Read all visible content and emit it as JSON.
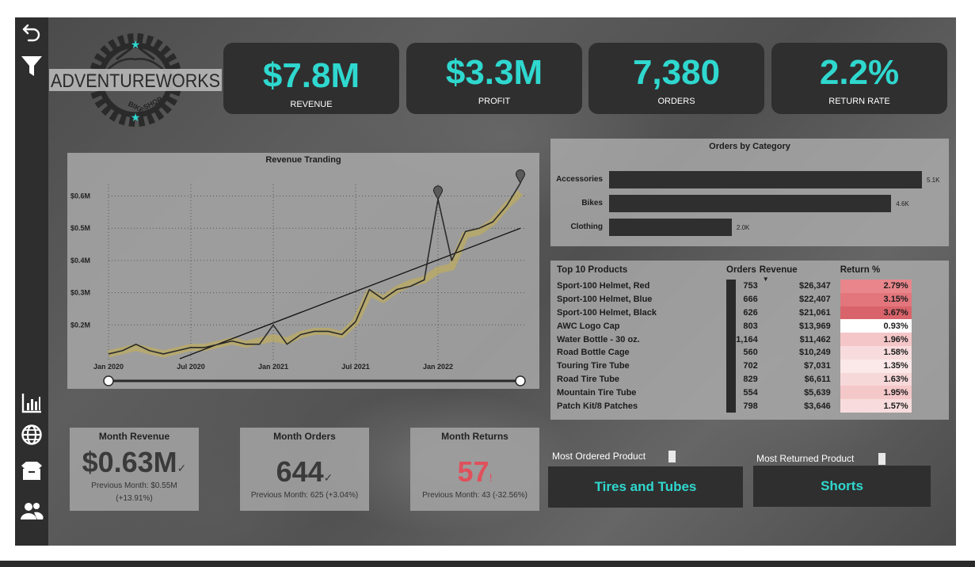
{
  "logo": {
    "brand": "ADVENTUREWORKS",
    "sub": "BIKE SHOP"
  },
  "sidebar": {
    "icons": [
      "back-arrow-icon",
      "filter-icon",
      "bar-chart-icon",
      "globe-icon",
      "box-icon",
      "users-icon"
    ]
  },
  "kpis": [
    {
      "value": "$7.8M",
      "label": "REVENUE"
    },
    {
      "value": "$3.3M",
      "label": "PROFIT"
    },
    {
      "value": "7,380",
      "label": "ORDERS"
    },
    {
      "value": "2.2%",
      "label": "RETURN RATE"
    }
  ],
  "revenue_chart": {
    "title": "Revenue Tranding",
    "y_ticks": [
      "$0.6M",
      "$0.5M",
      "$0.4M",
      "$0.3M",
      "$0.2M"
    ],
    "x_ticks": [
      "Jan 2020",
      "Jul 2020",
      "Jan 2021",
      "Jul 2021",
      "Jan 2022"
    ]
  },
  "chart_data": {
    "type": "line",
    "title": "Revenue Tranding",
    "x_start": "Jan 2020",
    "x_interval": "month",
    "ylim": [
      0.1,
      0.68
    ],
    "y_unit": "$M",
    "series": [
      {
        "values": [
          0.11,
          0.12,
          0.14,
          0.12,
          0.11,
          0.12,
          0.13,
          0.13,
          0.14,
          0.15,
          0.14,
          0.14,
          0.2,
          0.14,
          0.17,
          0.18,
          0.18,
          0.17,
          0.21,
          0.31,
          0.28,
          0.31,
          0.32,
          0.34,
          0.59,
          0.4,
          0.49,
          0.5,
          0.52,
          0.57,
          0.64
        ]
      },
      {
        "values": [
          0.11,
          0.12,
          0.13,
          0.12,
          0.11,
          0.12,
          0.13,
          0.13,
          0.14,
          0.15,
          0.14,
          0.15,
          0.16,
          0.15,
          0.17,
          0.18,
          0.18,
          0.17,
          0.21,
          0.3,
          0.28,
          0.31,
          0.33,
          0.34,
          0.37,
          0.38,
          0.48,
          0.49,
          0.52,
          0.57,
          0.61
        ]
      }
    ],
    "trend_line": {
      "start": 0.07,
      "end": 0.5
    },
    "grid": true
  },
  "orders_by_category": {
    "title": "Orders by Category",
    "rows": [
      {
        "label": "Accessories",
        "value": 5.1,
        "display": "5.1K"
      },
      {
        "label": "Bikes",
        "value": 4.6,
        "display": "4.6K"
      },
      {
        "label": "Clothing",
        "value": 2.0,
        "display": "2.0K"
      }
    ]
  },
  "top10": {
    "headers": {
      "product": "Top 10 Products",
      "orders": "Orders",
      "revenue": "Revenue",
      "ret": "Return %"
    },
    "rows": [
      {
        "product": "Sport-100 Helmet, Red",
        "orders": "753",
        "revenue": "$26,347",
        "ret": "2.79%",
        "ret_color": "#e8868b"
      },
      {
        "product": "Sport-100 Helmet, Blue",
        "orders": "666",
        "revenue": "$22,407",
        "ret": "3.15%",
        "ret_color": "#e2767c"
      },
      {
        "product": "Sport-100 Helmet, Black",
        "orders": "626",
        "revenue": "$21,061",
        "ret": "3.67%",
        "ret_color": "#d9636a"
      },
      {
        "product": "AWC Logo Cap",
        "orders": "803",
        "revenue": "$13,969",
        "ret": "0.93%",
        "ret_color": "#ffffff"
      },
      {
        "product": "Water Bottle - 30 oz.",
        "orders": "1,164",
        "revenue": "$11,462",
        "ret": "1.96%",
        "ret_color": "#f4c6c8"
      },
      {
        "product": "Road Bottle Cage",
        "orders": "560",
        "revenue": "$10,249",
        "ret": "1.58%",
        "ret_color": "#f8dcdd"
      },
      {
        "product": "Touring Tire Tube",
        "orders": "702",
        "revenue": "$7,031",
        "ret": "1.35%",
        "ret_color": "#fbe8e8"
      },
      {
        "product": "Road Tire Tube",
        "orders": "829",
        "revenue": "$6,611",
        "ret": "1.63%",
        "ret_color": "#f7d8d9"
      },
      {
        "product": "Mountain Tire Tube",
        "orders": "554",
        "revenue": "$5,639",
        "ret": "1.95%",
        "ret_color": "#f4c7c9"
      },
      {
        "product": "Patch Kit/8 Patches",
        "orders": "798",
        "revenue": "$3,646",
        "ret": "1.57%",
        "ret_color": "#f8dcdd"
      }
    ]
  },
  "cards": {
    "month_revenue": {
      "title": "Month Revenue",
      "value": "$0.63M",
      "prev": "Previous Month: $0.55M",
      "change": "(+13.91%)"
    },
    "month_orders": {
      "title": "Month Orders",
      "value": "644",
      "prev": "Previous Month: 625 (+3.04%)"
    },
    "month_returns": {
      "title": "Month Returns",
      "value": "57",
      "prev": "Previous Month: 43 (-32.56%)",
      "value_color": "#e0505b"
    }
  },
  "most_ordered": {
    "label": "Most Ordered Product",
    "value": "Tires and Tubes"
  },
  "most_returned": {
    "label": "Most Returned Product",
    "value": "Shorts"
  },
  "colors": {
    "accent": "#2fd8cf",
    "panel_dark": "#2f2f2f",
    "trend_gold": "#c8b04a"
  }
}
